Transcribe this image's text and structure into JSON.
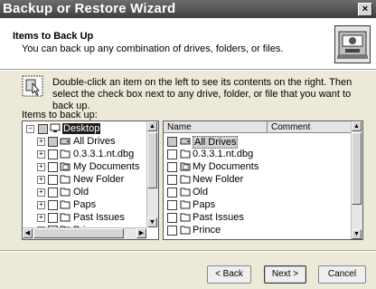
{
  "window": {
    "title": "Backup or Restore Wizard",
    "close_glyph": "×"
  },
  "header": {
    "title": "Items to Back Up",
    "subtitle": "You can back up any combination of drives, folders, or files."
  },
  "instruction": "Double-click an item on the left to see its contents on the right. Then select the check box next to any drive, folder, or file that you want to back up.",
  "items_label": "Items to back up:",
  "tree": {
    "items": [
      {
        "label": "Desktop",
        "selected": true,
        "checkbox": "gray",
        "icon": "desktop-icon"
      },
      {
        "label": "All Drives",
        "checkbox": "gray",
        "icon": "drive-icon"
      },
      {
        "label": "0.3.3.1.nt.dbg",
        "checkbox": "empty",
        "icon": "folder-icon"
      },
      {
        "label": "My Documents",
        "checkbox": "empty",
        "icon": "documents-icon"
      },
      {
        "label": "New Folder",
        "checkbox": "empty",
        "icon": "folder-icon"
      },
      {
        "label": "Old",
        "checkbox": "empty",
        "icon": "folder-icon"
      },
      {
        "label": "Paps",
        "checkbox": "empty",
        "icon": "folder-icon"
      },
      {
        "label": "Past Issues",
        "checkbox": "empty",
        "icon": "folder-icon"
      },
      {
        "label": "Prince",
        "checkbox": "empty",
        "icon": "folder-icon"
      }
    ]
  },
  "list": {
    "columns": [
      "Name",
      "Comment"
    ],
    "items": [
      {
        "label": "All Drives",
        "selected": true,
        "checkbox": "gray",
        "icon": "drive-icon"
      },
      {
        "label": "0.3.3.1.nt.dbg",
        "checkbox": "empty",
        "icon": "folder-icon"
      },
      {
        "label": "My Documents",
        "checkbox": "empty",
        "icon": "documents-icon"
      },
      {
        "label": "New Folder",
        "checkbox": "empty",
        "icon": "folder-icon"
      },
      {
        "label": "Old",
        "checkbox": "empty",
        "icon": "folder-icon"
      },
      {
        "label": "Paps",
        "checkbox": "empty",
        "icon": "folder-icon"
      },
      {
        "label": "Past Issues",
        "checkbox": "empty",
        "icon": "folder-icon"
      },
      {
        "label": "Prince",
        "checkbox": "empty",
        "icon": "folder-icon"
      }
    ]
  },
  "buttons": {
    "back": "< Back",
    "next": "Next >",
    "cancel": "Cancel"
  },
  "colors": {
    "titlebar": "#4a4a4a",
    "dialog_bg": "#ece9d8",
    "selection": "#1e1e1e"
  }
}
